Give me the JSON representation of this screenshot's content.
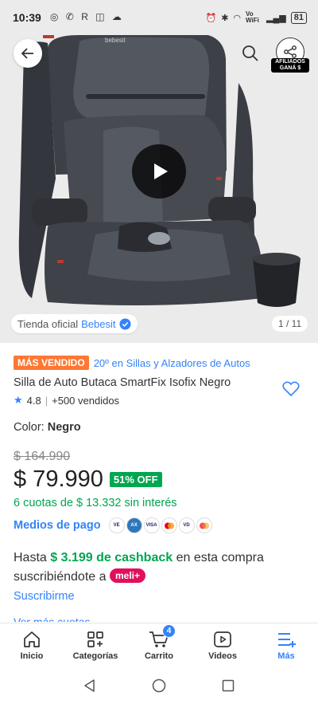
{
  "status_bar": {
    "time": "10:39",
    "left_icons": "◎ ✆ R ◫ ☁",
    "network": "Vo WiFi",
    "battery": "81"
  },
  "gallery": {
    "store_label": "Tienda oficial",
    "store_name": "Bebesit",
    "counter": "1 / 11",
    "affiliate_badge_line1": "AFILIADOS",
    "affiliate_badge_line2": "GANÁ $",
    "seat_brand": "bebesit"
  },
  "product": {
    "badge": "MÁS VENDIDO",
    "rank": "20º en Sillas y Alzadores de Autos",
    "title": "Silla de Auto Butaca SmartFix Isofix Negro",
    "rating": "4.8",
    "sold": "+500 vendidos",
    "color_label": "Color:",
    "color_value": "Negro",
    "old_price": "$ 164.990",
    "price": "$ 79.990",
    "discount": "51% OFF",
    "installments": "6 cuotas de $ 13.332 sin interés",
    "payment_link": "Medios de pago",
    "payment_methods": [
      "visa-electron",
      "amex",
      "visa",
      "mastercard",
      "visa-debit",
      "mastercard-debit"
    ],
    "cashback_pre": "Hasta",
    "cashback_amount": "$ 3.199 de cashback",
    "cashback_post": "en esta compra suscribiéndote a",
    "meli_plus": "meli+",
    "subscribe": "Suscribirme",
    "cut_link": "Ver más cuotas"
  },
  "bottom_nav": [
    {
      "label": "Inicio",
      "icon": "home-icon"
    },
    {
      "label": "Categorías",
      "icon": "categories-icon"
    },
    {
      "label": "Carrito",
      "icon": "cart-icon",
      "badge": "4"
    },
    {
      "label": "Videos",
      "icon": "video-icon"
    },
    {
      "label": "Más",
      "icon": "menu-icon",
      "active": true
    }
  ],
  "colors": {
    "accent": "#3483fa",
    "green": "#00a650",
    "orange": "#ff7733",
    "meli_plus": "#e0105b"
  }
}
